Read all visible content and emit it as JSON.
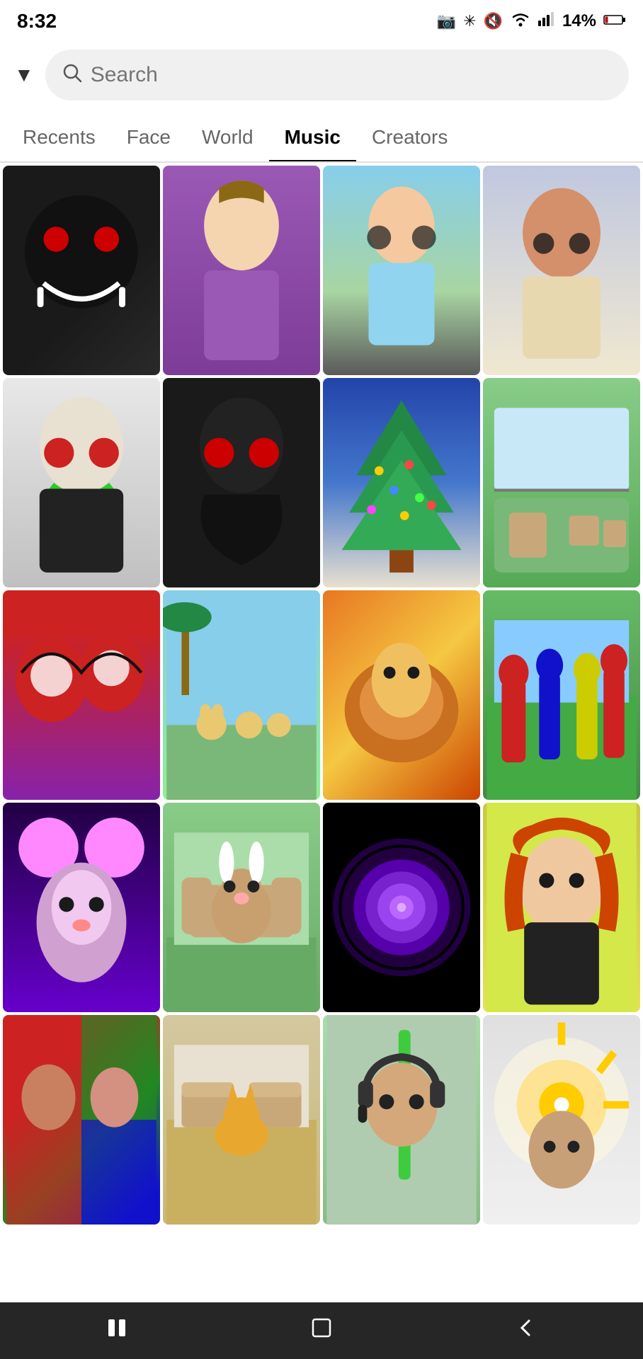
{
  "status_bar": {
    "time": "8:32",
    "battery": "14%",
    "camera_icon": "📷",
    "bluetooth_icon": "🔵",
    "mute_icon": "🔇",
    "wifi_icon": "📶",
    "signal_icon": "📶"
  },
  "search": {
    "placeholder": "Search",
    "dropdown_icon": "▼"
  },
  "tabs": [
    {
      "id": "recents",
      "label": "Recents",
      "active": false
    },
    {
      "id": "face",
      "label": "Face",
      "active": false
    },
    {
      "id": "world",
      "label": "World",
      "active": false
    },
    {
      "id": "music",
      "label": "Music",
      "active": true
    },
    {
      "id": "creators",
      "label": "Creators",
      "active": false
    }
  ],
  "grid_items": [
    {
      "id": 1,
      "bg": "#1a1a1a",
      "accent": "#cc0000"
    },
    {
      "id": 2,
      "bg": "#9b59b6",
      "accent": "#d5a0e0"
    },
    {
      "id": 3,
      "bg": "#7fb3c8",
      "accent": "#a8d5a2"
    },
    {
      "id": 4,
      "bg": "#c8a87a",
      "accent": "#8b6914"
    },
    {
      "id": 5,
      "bg": "#2c2c2c",
      "accent": "#28cc28"
    },
    {
      "id": 6,
      "bg": "#1a1a1a",
      "accent": "#cc0000"
    },
    {
      "id": 7,
      "bg": "#4a90d9",
      "accent": "#ffffff"
    },
    {
      "id": 8,
      "bg": "#5aaf5a",
      "accent": "#8b6914"
    },
    {
      "id": 9,
      "bg": "#cc2222",
      "accent": "#1111cc"
    },
    {
      "id": 10,
      "bg": "#a8d5a2",
      "accent": "#87ceeb"
    },
    {
      "id": 11,
      "bg": "#e87722",
      "accent": "#f5c842"
    },
    {
      "id": 12,
      "bg": "#5aaf5a",
      "accent": "#cc2222"
    },
    {
      "id": 13,
      "bg": "#6a1ab8",
      "accent": "#a855f7"
    },
    {
      "id": 14,
      "bg": "#7fb37f",
      "accent": "#f5e6ca"
    },
    {
      "id": 15,
      "bg": "#1a1a1a",
      "accent": "#7c3aed"
    },
    {
      "id": 16,
      "bg": "#d4a017",
      "accent": "#e0c878"
    },
    {
      "id": 17,
      "bg": "#cc2222",
      "accent": "#1a1a1a"
    },
    {
      "id": 18,
      "bg": "#c8a87a",
      "accent": "#8b6914"
    },
    {
      "id": 19,
      "bg": "#3a8a4a",
      "accent": "#28cc28"
    },
    {
      "id": 20,
      "bg": "#b0b0b0",
      "accent": "#888888"
    }
  ],
  "bottom_nav": {
    "pause_icon": "⏸",
    "home_icon": "⬛",
    "back_icon": "❮"
  }
}
